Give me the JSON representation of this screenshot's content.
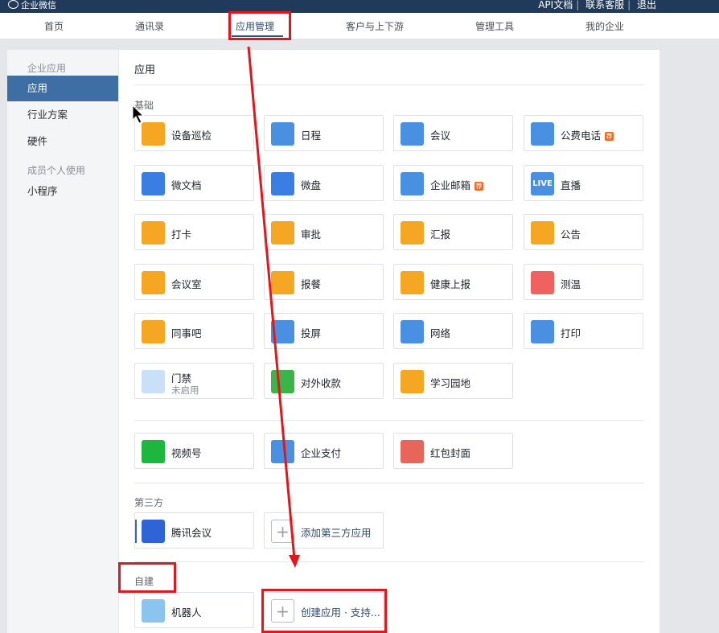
{
  "topbar": {
    "brand": "企业微信",
    "links": [
      "API文档",
      "联系客服",
      "退出"
    ]
  },
  "nav": {
    "tabs": [
      "首页",
      "通讯录",
      "应用管理",
      "客户与上下游",
      "管理工具",
      "我的企业"
    ],
    "active_index": 2
  },
  "sidebar": {
    "group1": "企业应用",
    "items1": [
      "应用",
      "行业方案",
      "硬件"
    ],
    "group2": "成员个人使用",
    "items2": [
      "小程序"
    ]
  },
  "main": {
    "title": "应用",
    "section_basic": "基础",
    "section_third": "第三方",
    "section_custom": "自建",
    "apps_basic": [
      {
        "name": "设备巡检",
        "icon": "device-inspection-icon",
        "color": "#f5a623"
      },
      {
        "name": "日程",
        "icon": "calendar-icon",
        "color": "#4a90e2"
      },
      {
        "name": "会议",
        "icon": "cloud-meeting-icon",
        "color": "#4a90e2"
      },
      {
        "name": "公费电话",
        "icon": "phone-icon",
        "color": "#4a90e2",
        "tag": "荐"
      },
      {
        "name": "微文档",
        "icon": "w-doc-icon",
        "color": "#3a7ee4"
      },
      {
        "name": "微盘",
        "icon": "drive-icon",
        "color": "#3a7ee4"
      },
      {
        "name": "企业邮箱",
        "icon": "mail-icon",
        "color": "#4a90e2",
        "tag": "荐"
      },
      {
        "name": "直播",
        "icon": "live-icon",
        "color": "#4a90e2",
        "icon_text": "LIVE"
      },
      {
        "name": "打卡",
        "icon": "location-pin-icon",
        "color": "#f5a623"
      },
      {
        "name": "审批",
        "icon": "stamp-icon",
        "color": "#f5a623"
      },
      {
        "name": "汇报",
        "icon": "report-icon",
        "color": "#f5a623"
      },
      {
        "name": "公告",
        "icon": "megaphone-icon",
        "color": "#f5a623"
      },
      {
        "name": "会议室",
        "icon": "meeting-room-icon",
        "color": "#f5a623"
      },
      {
        "name": "报餐",
        "icon": "meal-bowl-icon",
        "color": "#f5a623"
      },
      {
        "name": "健康上报",
        "icon": "health-report-icon",
        "color": "#f5a623"
      },
      {
        "name": "测温",
        "icon": "thermometer-icon",
        "color": "#f06262"
      },
      {
        "name": "同事吧",
        "icon": "colleague-icon",
        "color": "#f5a623"
      },
      {
        "name": "投屏",
        "icon": "screen-cast-icon",
        "color": "#4a90e2"
      },
      {
        "name": "网络",
        "icon": "network-icon",
        "color": "#4a90e2"
      },
      {
        "name": "打印",
        "icon": "printer-icon",
        "color": "#4a90e2"
      },
      {
        "name": "门禁",
        "icon": "door-access-icon",
        "color": "#8ab8ef",
        "status": "未启用"
      },
      {
        "name": "对外收款",
        "icon": "payment-icon",
        "color": "#3bb54a"
      },
      {
        "name": "学习园地",
        "icon": "learning-planet-icon",
        "color": "#f5a623"
      }
    ],
    "apps_wechat": [
      {
        "name": "视频号",
        "icon": "channels-icon",
        "color": "#1db63f"
      },
      {
        "name": "企业支付",
        "icon": "enterprise-pay-icon",
        "color": "#4a90e2"
      },
      {
        "name": "红包封面",
        "icon": "red-packet-icon",
        "color": "#e8655a"
      }
    ],
    "apps_third": [
      {
        "name": "腾讯会议",
        "icon": "tencent-meeting-icon",
        "color": "#2e64d6"
      },
      {
        "name": "添加第三方应用",
        "icon": "plus-icon",
        "add": true
      }
    ],
    "apps_custom": [
      {
        "name": "机器人",
        "icon": "robot-icon",
        "color": "#8cc4f0"
      },
      {
        "name": "创建应用 · 支持...",
        "icon": "plus-icon",
        "add": true
      }
    ]
  }
}
